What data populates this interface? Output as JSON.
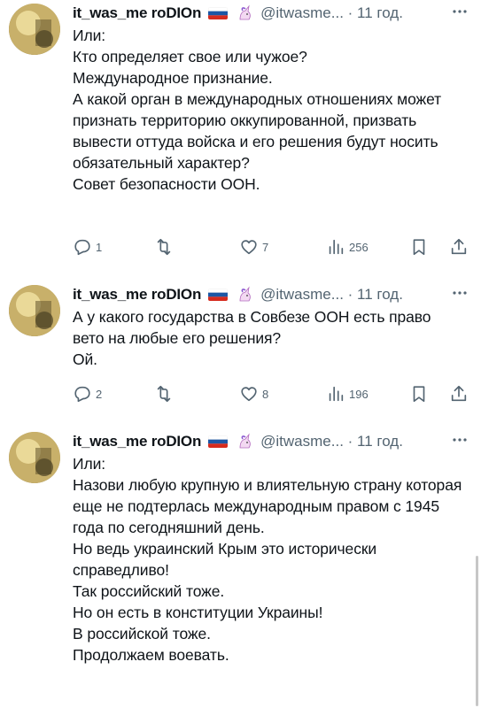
{
  "tweets": [
    {
      "name": "it_was_me roDIOn",
      "handle": "@itwasme... · 11 год.",
      "text": "Или:\nКто определяет свое или чужое?\nМеждународное признание.\nА какой орган в международных отношениях может признать территорию оккупированной, призвать вывести оттуда войска и его решения будут носить обязательный характер?\nСовет безопасности ООН.",
      "replies": "1",
      "likes": "7",
      "views": "256"
    },
    {
      "name": "it_was_me roDIOn",
      "handle": "@itwasme... · 11 год.",
      "text": "А у какого государства в Совбезе ООН есть право вето на любые его решения?\nОй.",
      "replies": "2",
      "likes": "8",
      "views": "196"
    },
    {
      "name": "it_was_me roDIOn",
      "handle": "@itwasme... · 11 год.",
      "text": "Или:\nНазови любую крупную и влиятельную страну которая еще не подтерлась международным правом с 1945 года по сегодняшний день.\nНо ведь украинский Крым это исторически справедливо!\nТак российский тоже.\nНо он есть в конституции Украины!\nВ российской тоже.\nПродолжаем воевать."
    }
  ],
  "icons": {
    "avatar": "avatar-image",
    "flag": "russia-flag-icon",
    "emoji": "unicorn-icon",
    "more": "more-icon",
    "reply": "reply-icon",
    "repost": "repost-icon",
    "like": "like-icon",
    "views": "views-icon",
    "bookmark": "bookmark-icon",
    "share": "share-icon"
  },
  "colors": {
    "text": "#0f1419",
    "secondary": "#536471"
  }
}
